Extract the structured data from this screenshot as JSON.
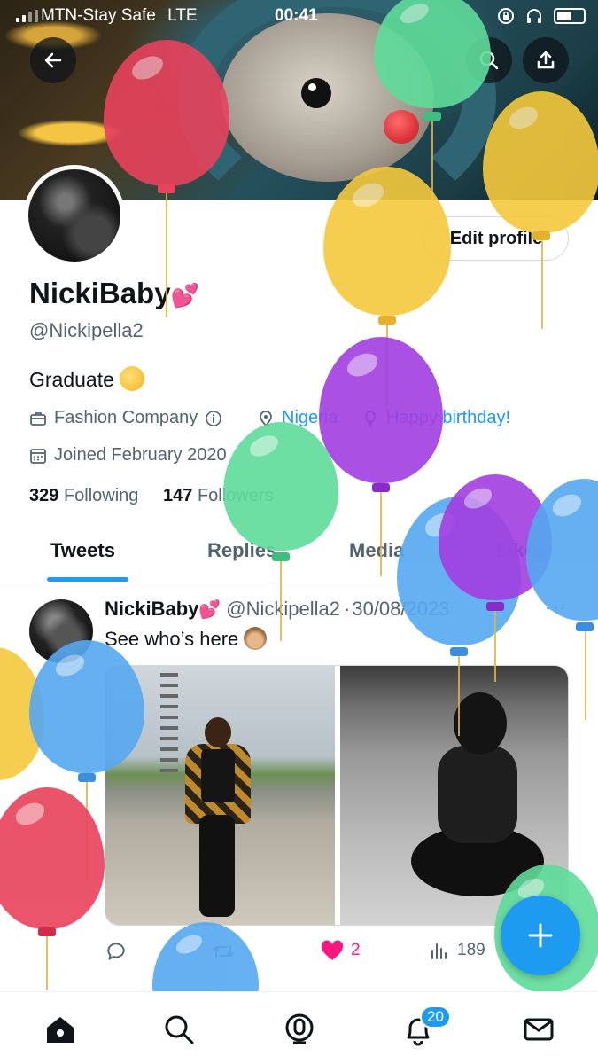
{
  "status_bar": {
    "carrier": "MTN-Stay Safe",
    "network": "LTE",
    "time": "00:41"
  },
  "profile": {
    "name": "NickiBaby",
    "name_emoji": "💕",
    "handle": "@Nickipella2",
    "bio": "Graduate",
    "work": "Fashion Company",
    "location": "Nigeria",
    "birthday": "Happy birthday!",
    "joined": "Joined February 2020",
    "following_count": "329",
    "following_label": "Following",
    "followers_count": "147",
    "followers_label": "Followers",
    "edit_profile_label": "Edit profile"
  },
  "tabs": [
    "Tweets",
    "Replies",
    "Media",
    "Likes"
  ],
  "tweet": {
    "author": "NickiBaby",
    "handle": "@Nickipella2",
    "date": "30/08/2023",
    "text": "See who’s here",
    "likes": "2",
    "views": "189"
  },
  "notifications_badge": "20",
  "colors": {
    "accent": "#1d9bf0",
    "like": "#f91880",
    "balloon_red": "#e8425c",
    "balloon_yellow": "#f5c93c",
    "balloon_green": "#5fdc9a",
    "balloon_purple": "#a13ee0",
    "balloon_blue": "#55a8f0"
  }
}
